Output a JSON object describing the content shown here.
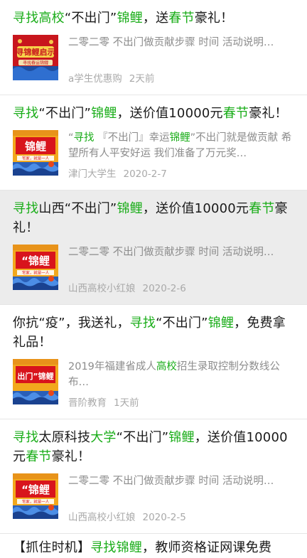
{
  "colors": {
    "highlight": "#1aad19",
    "selected_bg": "#ececec",
    "meta": "#a9a9a9",
    "desc": "#8c8c8c"
  },
  "items": [
    {
      "title_parts": [
        {
          "t": "寻找高校",
          "hl": true
        },
        {
          "t": "“不出门”",
          "hl": false
        },
        {
          "t": "锦鲤",
          "hl": true
        },
        {
          "t": "，送",
          "hl": false
        },
        {
          "t": "春节",
          "hl": true
        },
        {
          "t": "豪礼！",
          "hl": false
        }
      ],
      "desc_parts": [
        {
          "t": "二零二零 不出门做贡献步骤 时间 活动说明…",
          "hl": false
        }
      ],
      "source": "a学生优惠购",
      "date": "2天前",
      "thumb": "red-poster",
      "thumb_text": "寻锦鲤启示",
      "thumb_sub": "寻找春运锦鲤",
      "selected": false
    },
    {
      "title_parts": [
        {
          "t": "寻找",
          "hl": true
        },
        {
          "t": "“不出门”",
          "hl": false
        },
        {
          "t": "锦鲤",
          "hl": true
        },
        {
          "t": "，送价值10000元",
          "hl": false
        },
        {
          "t": "春节",
          "hl": true
        },
        {
          "t": "豪礼！",
          "hl": false
        }
      ],
      "desc_parts": [
        {
          "t": "“",
          "hl": false
        },
        {
          "t": "寻找",
          "hl": true
        },
        {
          "t": " 『不出门』幸运",
          "hl": false
        },
        {
          "t": "锦鲤",
          "hl": true
        },
        {
          "t": "”不出门就是做贡献 希望所有人平安好运 我们准备了万元奖…",
          "hl": false
        }
      ],
      "source": "津门大学生",
      "date": "2020-2-7",
      "thumb": "wave-poster",
      "thumb_text": "锦鲤",
      "thumb_sub": "宅家，就是一人",
      "selected": false
    },
    {
      "title_parts": [
        {
          "t": "寻找",
          "hl": true
        },
        {
          "t": "山西“不出门”",
          "hl": false
        },
        {
          "t": "锦鲤",
          "hl": true
        },
        {
          "t": "，送价值10000元",
          "hl": false
        },
        {
          "t": "春节",
          "hl": true
        },
        {
          "t": "豪礼！",
          "hl": false
        }
      ],
      "desc_parts": [
        {
          "t": "二零二零 不出门做贡献步骤 时间 活动说明…",
          "hl": false
        }
      ],
      "source": "山西高校小红娘",
      "date": "2020-2-6",
      "thumb": "wave-poster",
      "thumb_text": "“锦鲤",
      "thumb_sub": "宅家，就是一人",
      "selected": true
    },
    {
      "title_parts": [
        {
          "t": "你抗“疫”，我送礼，",
          "hl": false
        },
        {
          "t": "寻找",
          "hl": true
        },
        {
          "t": "“不出门”",
          "hl": false
        },
        {
          "t": "锦鲤",
          "hl": true
        },
        {
          "t": "，免费拿礼品！",
          "hl": false
        }
      ],
      "desc_parts": [
        {
          "t": "2019年福建省成人",
          "hl": false
        },
        {
          "t": "高校",
          "hl": true
        },
        {
          "t": "招生录取控制分数线公布…",
          "hl": false
        }
      ],
      "source": "晋阶教育",
      "date": "1天前",
      "thumb": "wave-poster-2",
      "thumb_text": "出门”锦鲤",
      "thumb_sub": "",
      "selected": false
    },
    {
      "title_parts": [
        {
          "t": "寻找",
          "hl": true
        },
        {
          "t": "太原科技",
          "hl": false
        },
        {
          "t": "大学",
          "hl": true
        },
        {
          "t": "“不出门”",
          "hl": false
        },
        {
          "t": "锦鲤",
          "hl": true
        },
        {
          "t": "，送价值10000元",
          "hl": false
        },
        {
          "t": "春节",
          "hl": true
        },
        {
          "t": "豪礼！",
          "hl": false
        }
      ],
      "desc_parts": [
        {
          "t": "二零二零 不出门做贡献步骤 时间 活动说明…",
          "hl": false
        }
      ],
      "source": "山西高校小红娘",
      "date": "2020-2-5",
      "thumb": "wave-poster",
      "thumb_text": "“锦鲤",
      "thumb_sub": "宅家，就是一人",
      "selected": false
    }
  ],
  "partial_item": {
    "title_parts": [
      {
        "t": "【抓住时机】",
        "hl": false
      },
      {
        "t": "寻找锦鲤",
        "hl": true
      },
      {
        "t": "，教师资格证网课免费",
        "hl": false
      }
    ]
  }
}
